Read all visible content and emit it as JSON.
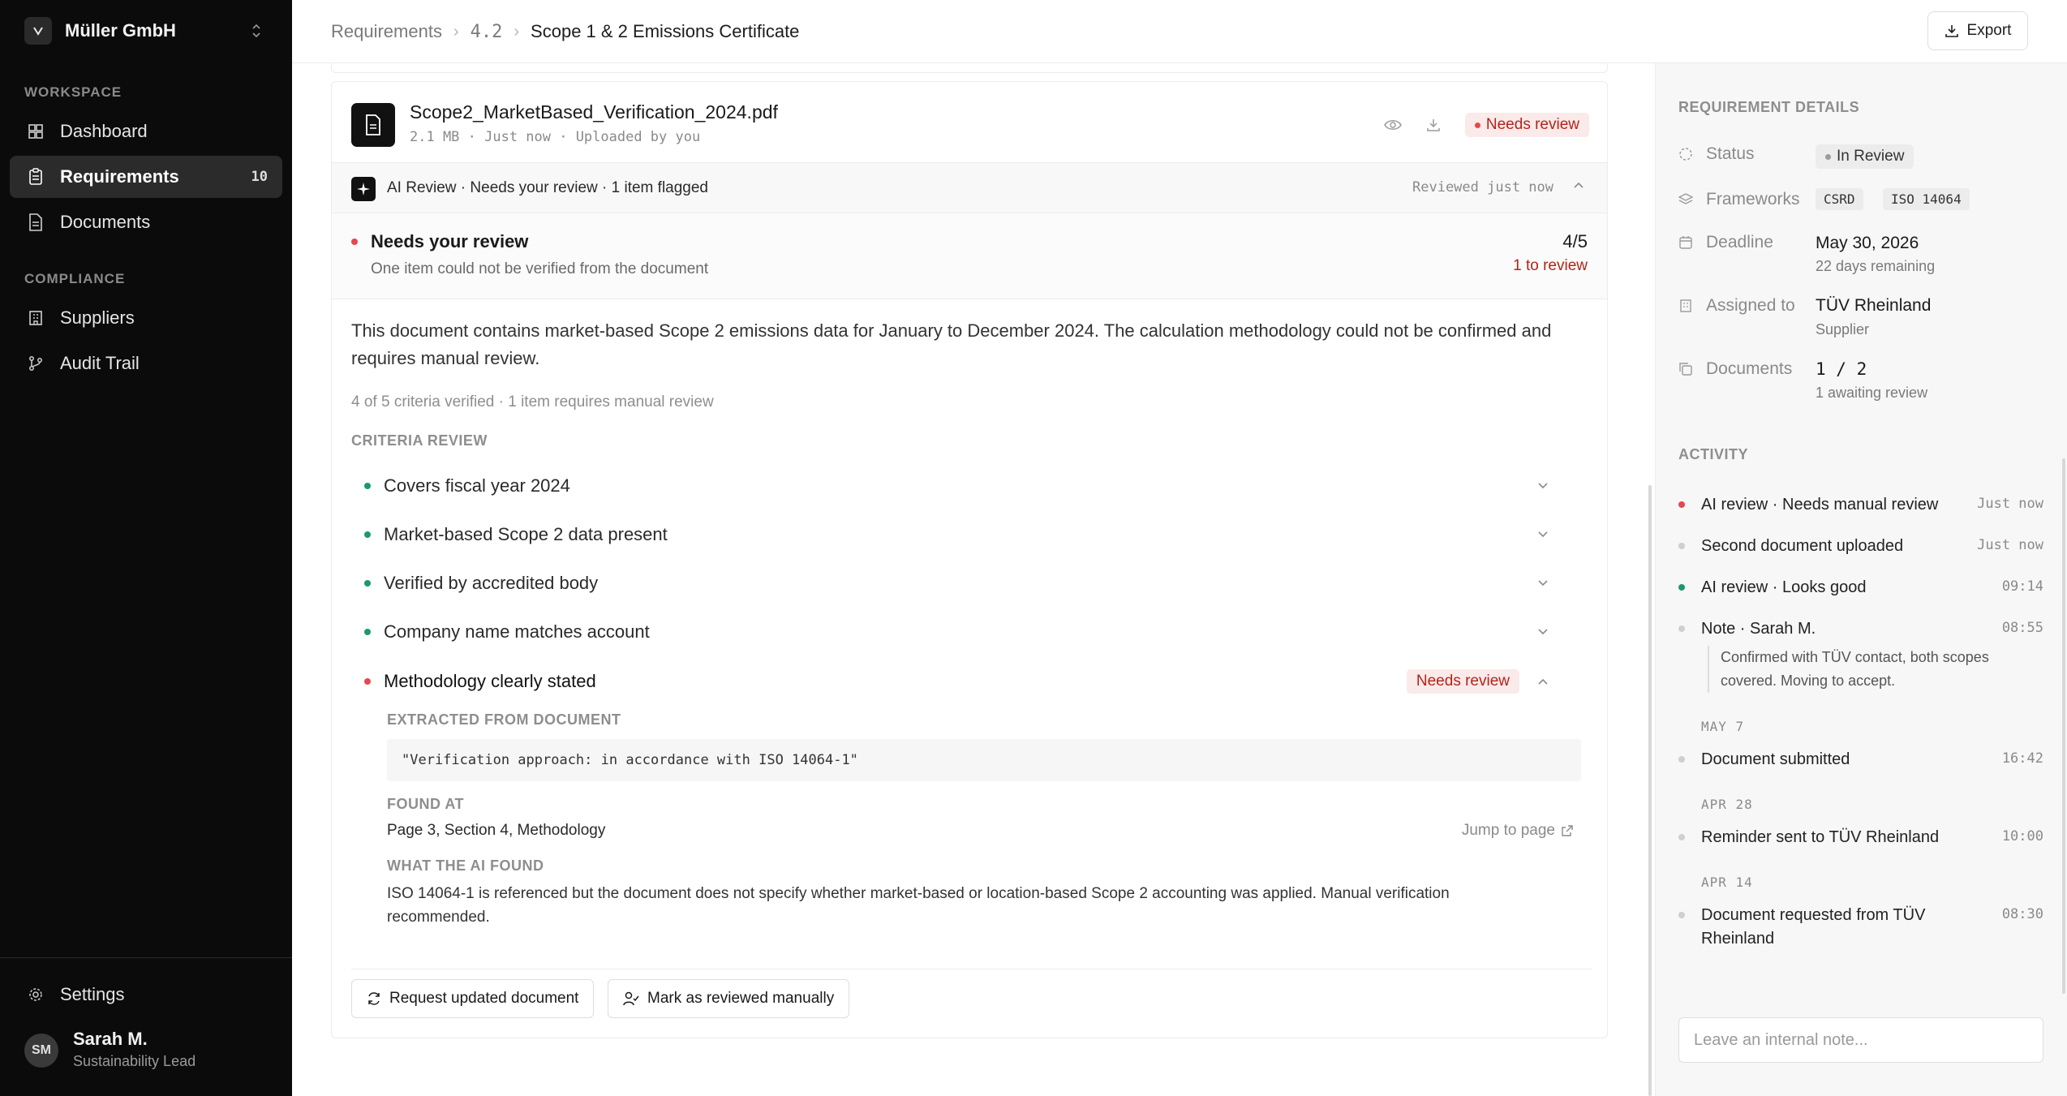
{
  "org": {
    "name": "Müller GmbH"
  },
  "nav": {
    "workspace_label": "WORKSPACE",
    "compliance_label": "COMPLIANCE",
    "dashboard": "Dashboard",
    "requirements": "Requirements",
    "requirements_count": "10",
    "documents": "Documents",
    "suppliers": "Suppliers",
    "audit_trail": "Audit Trail",
    "settings": "Settings"
  },
  "user": {
    "initials": "SM",
    "name": "Sarah M.",
    "role": "Sustainability Lead"
  },
  "breadcrumb": {
    "root": "Requirements",
    "section": "4.2",
    "current": "Scope 1 & 2 Emissions Certificate"
  },
  "header": {
    "export_label": "Export"
  },
  "file": {
    "name": "Scope2_MarketBased_Verification_2024.pdf",
    "meta": "2.1 MB · Just now · Uploaded by you",
    "status": "Needs review"
  },
  "ai_review": {
    "summary_line": "AI Review · Needs your review · 1 item flagged",
    "reviewed": "Reviewed just now",
    "title": "Needs your review",
    "subtitle": "One item could not be verified from the document",
    "score": "4/5",
    "to_review": "1 to review",
    "description": "This document contains market-based Scope 2 emissions data for January to December 2024. The calculation methodology could not be confirmed and requires manual review.",
    "criteria_stat": "4 of 5 criteria verified · 1 item requires manual review",
    "criteria_heading": "CRITERIA REVIEW",
    "criteria": [
      {
        "label": "Covers fiscal year 2024",
        "status": "ok"
      },
      {
        "label": "Market-based Scope 2 data present",
        "status": "ok"
      },
      {
        "label": "Verified by accredited body",
        "status": "ok"
      },
      {
        "label": "Company name matches account",
        "status": "ok"
      },
      {
        "label": "Methodology clearly stated",
        "status": "review",
        "badge": "Needs review"
      }
    ],
    "extracted_heading": "EXTRACTED FROM DOCUMENT",
    "extracted_quote": "\"Verification approach: in accordance with ISO 14064-1\"",
    "found_at_heading": "FOUND AT",
    "found_at": "Page 3, Section 4, Methodology",
    "jump_label": "Jump to page",
    "what_found_heading": "WHAT THE AI FOUND",
    "what_found": "ISO 14064-1 is referenced but the document does not specify whether market-based or location-based Scope 2 accounting was applied. Manual verification recommended."
  },
  "buttons": {
    "request_updated": "Request updated document",
    "mark_reviewed": "Mark as reviewed manually"
  },
  "details": {
    "heading": "REQUIREMENT DETAILS",
    "status_label": "Status",
    "status_value": "In Review",
    "frameworks_label": "Frameworks",
    "frameworks": [
      "CSRD",
      "ISO 14064"
    ],
    "deadline_label": "Deadline",
    "deadline_value": "May 30, 2026",
    "deadline_sub": "22 days remaining",
    "assigned_label": "Assigned to",
    "assigned_value": "TÜV Rheinland",
    "assigned_sub": "Supplier",
    "documents_label": "Documents",
    "documents_value": "1 / 2",
    "documents_sub": "1 awaiting review"
  },
  "activity": {
    "heading": "ACTIVITY",
    "items": [
      {
        "text": "AI review · Needs manual review",
        "time": "Just now"
      },
      {
        "text": "Second document uploaded",
        "time": "Just now"
      },
      {
        "text": "AI review · Looks good",
        "time": "09:14"
      },
      {
        "text": "Note · Sarah M.",
        "time": "08:55"
      },
      {
        "text": "Document submitted",
        "time": "16:42"
      },
      {
        "text": "Reminder sent to TÜV Rheinland",
        "time": "10:00"
      },
      {
        "text": "Document requested from TÜV Rheinland",
        "time": "08:30"
      }
    ],
    "note_text": "Confirmed with TÜV contact, both scopes covered. Moving to accept.",
    "date_may7": "MAY 7",
    "date_apr28": "APR 28",
    "date_apr14": "APR 14",
    "note_placeholder": "Leave an internal note..."
  },
  "colors": {
    "accent_red": "#e5484d",
    "accent_green": "#1a9a6c",
    "sidebar_bg": "#0b0b0b"
  }
}
